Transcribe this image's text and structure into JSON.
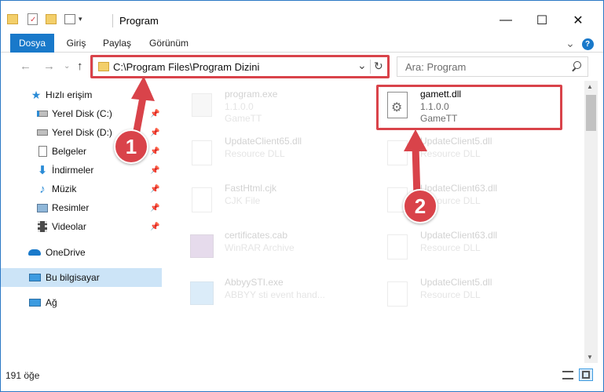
{
  "window": {
    "title": "Program",
    "minimize": "—",
    "maximize": "☐",
    "close": "✕"
  },
  "ribbon": {
    "tabs": [
      "Dosya",
      "Giriş",
      "Paylaş",
      "Görünüm"
    ],
    "expand": "⌄",
    "help": "?"
  },
  "address": {
    "path": "C:\\Program Files\\Program Dizini",
    "dropdown": "⌄",
    "refresh": "↻"
  },
  "search": {
    "placeholder": "Ara: Program"
  },
  "nav_arrows": {
    "back": "←",
    "forward": "→",
    "recent": "⌄",
    "up": "↑"
  },
  "sidebar": {
    "quick_access": "Hızlı erişim",
    "items": [
      {
        "label": "Yerel Disk (C:)",
        "icon": "drive-icon"
      },
      {
        "label": "Yerel Disk (D:)",
        "icon": "drive-icon"
      },
      {
        "label": "Belgeler",
        "icon": "documents-icon"
      },
      {
        "label": "İndirmeler",
        "icon": "downloads-icon"
      },
      {
        "label": "Müzik",
        "icon": "music-icon"
      },
      {
        "label": "Resimler",
        "icon": "pictures-icon"
      },
      {
        "label": "Videolar",
        "icon": "videos-icon"
      }
    ],
    "onedrive": "OneDrive",
    "this_pc": "Bu bilgisayar",
    "network": "Ağ"
  },
  "files": [
    {
      "name": "program.exe",
      "line2": "1.1.0.0",
      "line3": "GameTT",
      "icon": "exe-icon",
      "faded": true
    },
    {
      "name": "gamett.dll",
      "line2": "1.1.0.0",
      "line3": "GameTT",
      "icon": "dll-icon",
      "faded": false,
      "highlighted": true
    },
    {
      "name": "UpdateClient65.dll",
      "line2": "Resource DLL",
      "line3": "",
      "icon": "dll-icon",
      "faded": true
    },
    {
      "name": "UpdateClient5.dll",
      "line2": "Resource DLL",
      "line3": "",
      "icon": "dll-icon",
      "faded": true
    },
    {
      "name": "FastHtml.cjk",
      "line2": "CJK File",
      "line3": "",
      "icon": "file-icon",
      "faded": true
    },
    {
      "name": "UpdateClient63.dll",
      "line2": "Resource DLL",
      "line3": "",
      "icon": "dll-icon",
      "faded": true
    },
    {
      "name": "certificates.cab",
      "line2": "WinRAR Archive",
      "line3": "",
      "icon": "archive-icon",
      "faded": true
    },
    {
      "name": "UpdateClient63.dll",
      "line2": "Resource DLL",
      "line3": "",
      "icon": "dll-icon",
      "faded": true
    },
    {
      "name": "AbbyySTI.exe",
      "line2": "ABBYY sti event hand...",
      "line3": "",
      "icon": "exe-icon",
      "faded": true
    },
    {
      "name": "UpdateClient5.dll",
      "line2": "Resource DLL",
      "line3": "",
      "icon": "dll-icon",
      "faded": true
    }
  ],
  "status": {
    "count": "191 öğe"
  },
  "callouts": {
    "one": "1",
    "two": "2"
  },
  "colors": {
    "accent": "#1979ca",
    "highlight": "#d9434a",
    "selected": "#cce4f7"
  }
}
